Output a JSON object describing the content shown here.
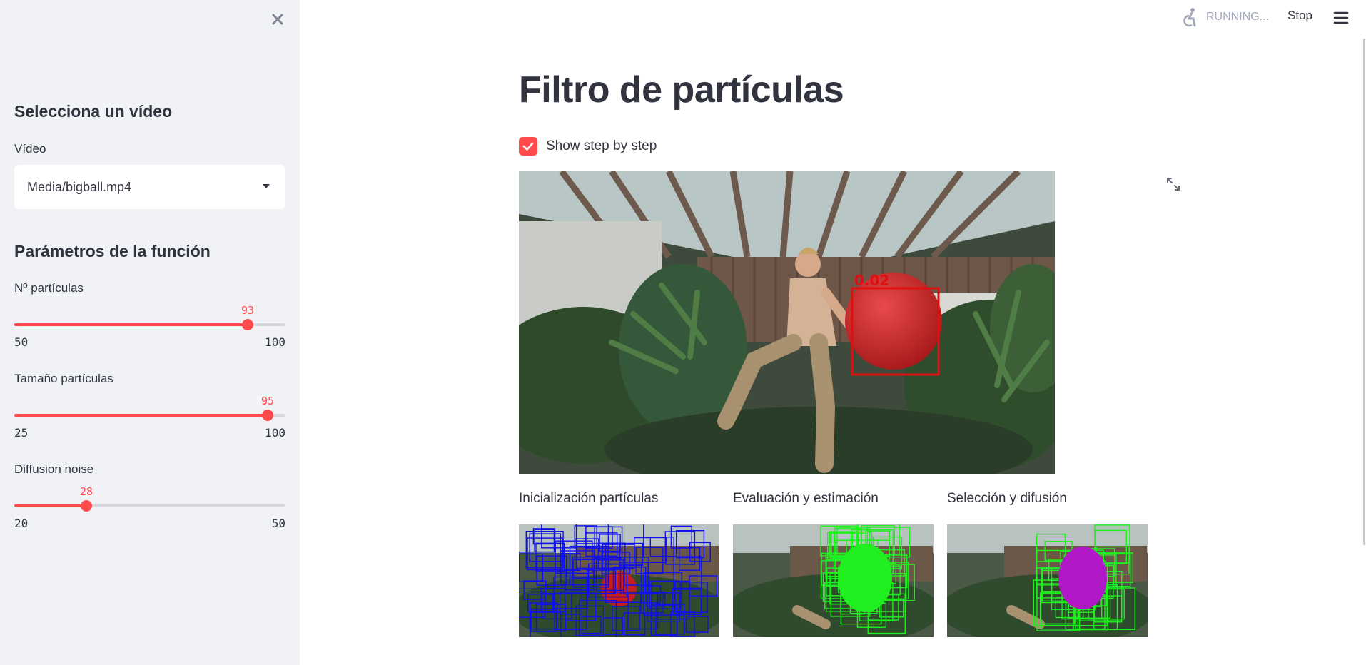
{
  "sidebar": {
    "video_section_title": "Selecciona un vídeo",
    "video_label": "Vídeo",
    "video_value": "Media/bigball.mp4",
    "params_section_title": "Parámetros de la función",
    "sliders": [
      {
        "label": "Nº partículas",
        "value": "93",
        "min": "50",
        "max": "100",
        "fraction": 0.86
      },
      {
        "label": "Tamaño partículas",
        "value": "95",
        "min": "25",
        "max": "100",
        "fraction": 0.9333
      },
      {
        "label": "Diffusion noise",
        "value": "28",
        "min": "20",
        "max": "50",
        "fraction": 0.2667
      }
    ]
  },
  "header": {
    "status_text": "RUNNING...",
    "stop_label": "Stop"
  },
  "main": {
    "title": "Filtro de partículas",
    "checkbox_label": "Show step by step",
    "checkbox_checked": true,
    "main_image_score": "0.02",
    "captions": [
      "Inicialización partículas",
      "Evaluación y estimación",
      "Selección y difusión"
    ]
  },
  "colors": {
    "accent": "#ff4b4b",
    "sidebar_bg": "#f0f2f6",
    "text": "#31333f"
  }
}
